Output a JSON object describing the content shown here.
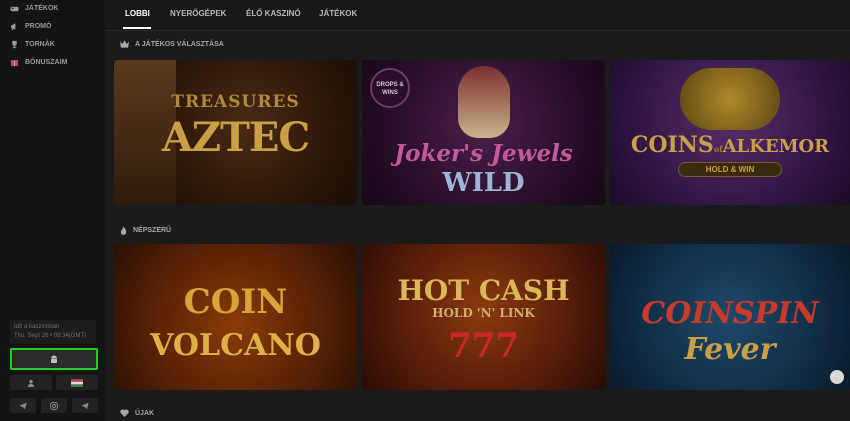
{
  "sidebar": {
    "items": [
      {
        "label": "JÁTÉKOK",
        "icon": "gamepad-icon"
      },
      {
        "label": "PROMÓ",
        "icon": "megaphone-icon"
      },
      {
        "label": "TORNÁK",
        "icon": "trophy-icon"
      },
      {
        "label": "BÓNUSZAIM",
        "icon": "gift-icon"
      }
    ],
    "time_caption": "Idő a kaszinóban",
    "datetime": "Thu, Sept 26 • 09:34(GMT)",
    "android_icon": "android-icon",
    "bottom_icons": [
      "user-icon",
      "flag-icon",
      "telegram-icon",
      "instagram-icon",
      "send-icon"
    ]
  },
  "nav": {
    "tabs": [
      "LOBBI",
      "NYERŐGÉPEK",
      "ÉLŐ KASZINÓ",
      "JÁTÉKOK"
    ],
    "active": "LOBBI"
  },
  "sections": [
    {
      "title": "A JÁTÉKOS VÁLASZTÁSA",
      "icon": "crown-icon"
    },
    {
      "title": "NÉPSZERŰ",
      "icon": "fire-icon"
    },
    {
      "title": "ÚJAK",
      "icon": "heart-icon"
    }
  ],
  "games_row1": [
    {
      "title": "TREASURES",
      "subtitle": "AZTEC",
      "brand": "TREASURES OF AZTEC"
    },
    {
      "badge": "DROPS & WINS",
      "title": "Joker's Jewels",
      "subtitle": "WILD"
    },
    {
      "title": "COINS",
      "connector": "of",
      "title2": "ALKEMOR",
      "subtitle": "HOLD & WIN"
    }
  ],
  "games_row2": [
    {
      "title": "COIN",
      "subtitle": "VOLCANO"
    },
    {
      "title": "HOT CASH",
      "subtitle": "HOLD 'N' LINK",
      "extra": "777"
    },
    {
      "title": "COINSPIN",
      "subtitle": "Fever"
    }
  ],
  "colors": {
    "accent": "#22d11f",
    "bg": "#1b1b1b",
    "sidebar": "#141414"
  }
}
